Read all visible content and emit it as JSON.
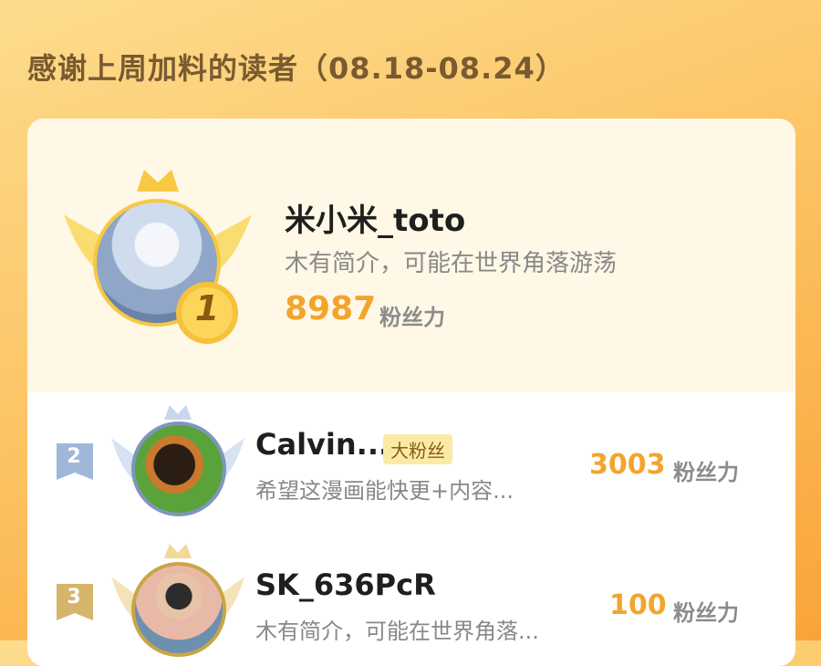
{
  "header": {
    "title": "感谢上周加料的读者（08.18-08.24）"
  },
  "colors": {
    "accent": "#f2a52c",
    "gold": "#f7c842",
    "silver": "#9fb8d9",
    "bronze": "#d6b56a"
  },
  "readers": [
    {
      "rank": "1",
      "name": "米小米_toto",
      "bio": "木有简介，可能在世界角落游荡",
      "score": "8987",
      "unit": "粉丝力",
      "badge": ""
    },
    {
      "rank": "2",
      "name": "Calvin...",
      "bio": "希望这漫画能快更+内容...",
      "score": "3003",
      "unit": "粉丝力",
      "badge": "大粉丝"
    },
    {
      "rank": "3",
      "name": "SK_636PcR",
      "bio": "木有简介，可能在世界角落...",
      "score": "100",
      "unit": "粉丝力",
      "badge": ""
    }
  ]
}
